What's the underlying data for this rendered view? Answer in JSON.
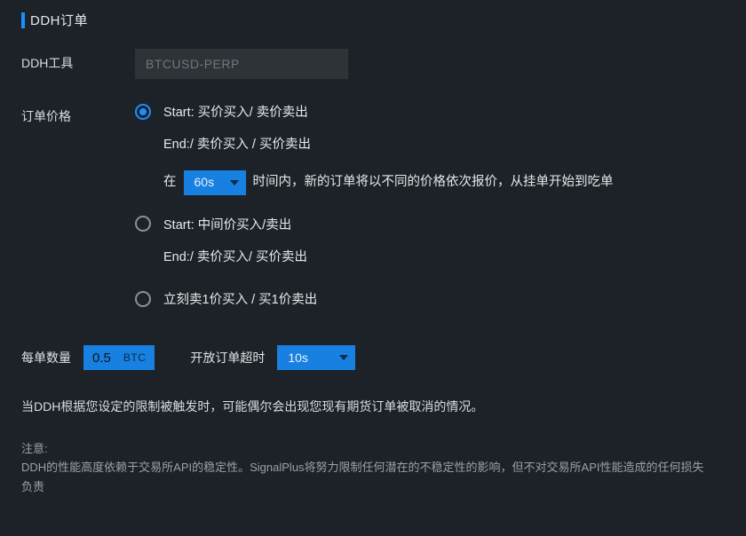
{
  "section": {
    "title": "DDH订单"
  },
  "tool": {
    "label": "DDH工具",
    "placeholder": "BTCUSD-PERP",
    "value": ""
  },
  "price": {
    "label": "订单价格",
    "options": [
      {
        "start": "Start: 买价买入/ 卖价卖出",
        "end": "End:/ 卖价买入 / 买价卖出",
        "sweep_prefix": "在",
        "sweep_duration": "60s",
        "sweep_suffix": "时间内，新的订单将以不同的价格依次报价，从挂单开始到吃单"
      },
      {
        "start": "Start: 中间价买入/卖出",
        "end": "End:/ 卖价买入/ 买价卖出"
      },
      {
        "label": "立刻卖1价买入 / 买1价卖出"
      }
    ]
  },
  "qty": {
    "label": "每单数量",
    "value": "0.5",
    "unit": "BTC"
  },
  "timeout": {
    "label": "开放订单超时",
    "value": "10s"
  },
  "info": "当DDH根据您设定的限制被触发时，可能偶尔会出现您现有期货订单被取消的情况。",
  "note": {
    "label": "注意:",
    "text": "DDH的性能高度依赖于交易所API的稳定性。SignalPlus将努力限制任何潜在的不稳定性的影响，但不对交易所API性能造成的任何损失负责"
  },
  "colors": {
    "accent": "#1890ff",
    "bg": "#1d2228"
  }
}
